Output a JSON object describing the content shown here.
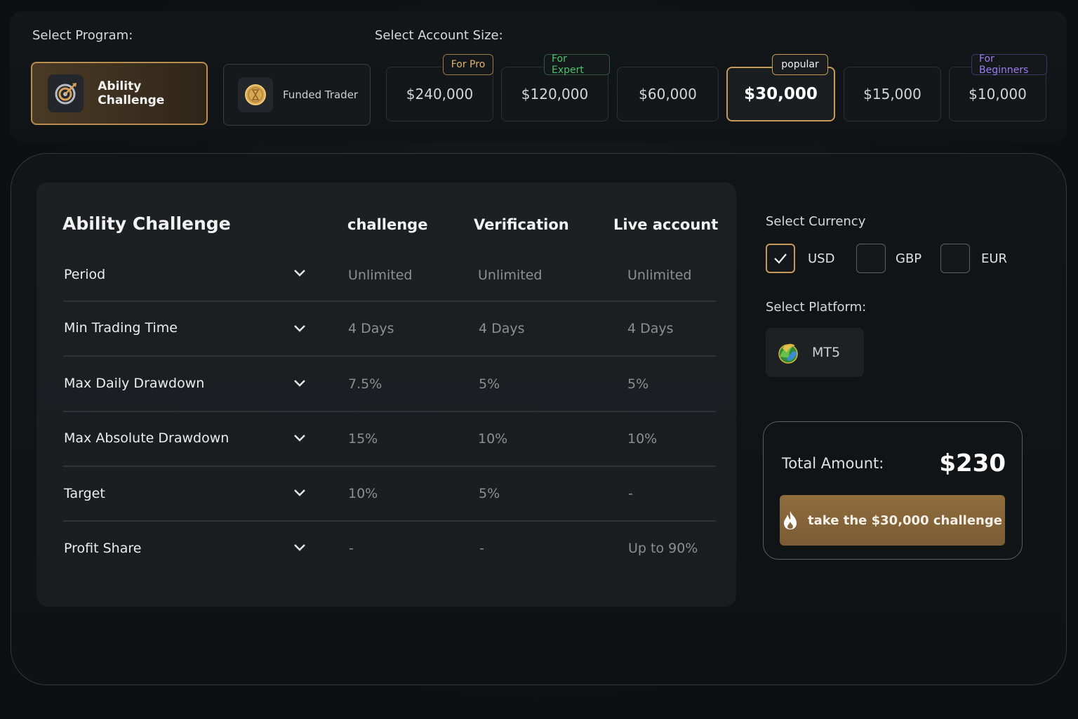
{
  "program": {
    "label": "Select Program:",
    "options": [
      {
        "name": "Ability Challenge",
        "icon": "target-icon",
        "selected": true
      },
      {
        "name": "Funded Trader",
        "icon": "hourglass-coin-icon",
        "selected": false
      }
    ]
  },
  "account_size": {
    "label": "Select Account Size:",
    "options": [
      {
        "value": "$240,000",
        "badge": "For Pro"
      },
      {
        "value": "$120,000",
        "badge": "For Expert"
      },
      {
        "value": "$60,000",
        "badge": ""
      },
      {
        "value": "$30,000",
        "badge": "popular",
        "selected": true
      },
      {
        "value": "$15,000",
        "badge": ""
      },
      {
        "value": "$10,000",
        "badge": "For Beginners"
      }
    ]
  },
  "table": {
    "title": "Ability Challenge",
    "columns": [
      "challenge",
      "Verification",
      "Live account"
    ],
    "rows": [
      {
        "label": "Period",
        "values": [
          "Unlimited",
          "Unlimited",
          "Unlimited"
        ]
      },
      {
        "label": "Min Trading Time",
        "values": [
          "4 Days",
          "4 Days",
          "4 Days"
        ]
      },
      {
        "label": "Max Daily Drawdown",
        "values": [
          "7.5%",
          "5%",
          "5%"
        ]
      },
      {
        "label": "Max Absolute Drawdown",
        "values": [
          "15%",
          "10%",
          "10%"
        ]
      },
      {
        "label": "Target",
        "values": [
          "10%",
          "5%",
          "-"
        ]
      },
      {
        "label": "Profit Share",
        "values": [
          "-",
          "-",
          "Up to 90%"
        ]
      }
    ]
  },
  "currency": {
    "label": "Select Currency",
    "options": [
      {
        "code": "USD",
        "checked": true
      },
      {
        "code": "GBP",
        "checked": false
      },
      {
        "code": "EUR",
        "checked": false
      }
    ]
  },
  "platform": {
    "label": "Select Platform:",
    "name": "MT5",
    "icon": "metatrader-icon"
  },
  "summary": {
    "total_label": "Total Amount:",
    "total_value": "$230",
    "cta_label": "take the $30,000 challenge",
    "cta_icon": "flame-icon"
  },
  "colors": {
    "accent_gold": "#c49a58",
    "expert_green": "#4cc36a",
    "beginner_purple": "#9b7cf2",
    "pro_gold": "#e0b56e"
  }
}
